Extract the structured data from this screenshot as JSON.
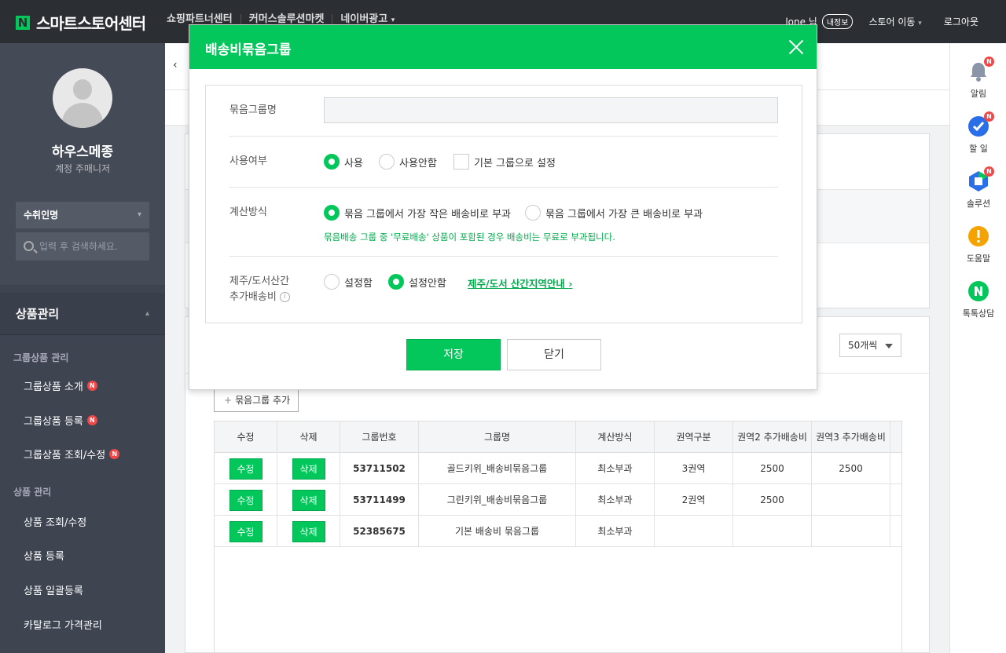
{
  "header": {
    "logo_letter": "N",
    "logo_text": "스마트스토어센터",
    "nav": [
      "쇼핑파트너센터",
      "커머스솔루션마켓",
      "네이버광고"
    ],
    "user": "lone 님",
    "info_badge": "내정보",
    "store_move": "스토어 이동",
    "logout": "로그아웃"
  },
  "sidebar": {
    "store_name": "하우스메종",
    "role": "계정 주매니저",
    "select_value": "수취인명",
    "search_placeholder": "입력 후 검색하세요.",
    "menu_head": "상품관리",
    "sections": [
      {
        "title": "그룹상품 관리",
        "items": [
          {
            "label": "그룹상품 소개",
            "badge": "N"
          },
          {
            "label": "그룹상품 등록",
            "badge": "N"
          },
          {
            "label": "그룹상품 조회/수정",
            "badge": "N"
          }
        ]
      },
      {
        "title": "상품 관리",
        "items": [
          {
            "label": "상품 조회/수정"
          },
          {
            "label": "상품 등록"
          },
          {
            "label": "상품 일괄등록"
          },
          {
            "label": "카탈로그 가격관리"
          }
        ]
      }
    ]
  },
  "main": {
    "per_page": "50개씩",
    "add_group": "묶음그룹 추가",
    "table": {
      "columns": [
        "수정",
        "삭제",
        "그룹번호",
        "그룹명",
        "계산방식",
        "권역구분",
        "권역2 추가배송비",
        "권역3 추가배송비"
      ],
      "edit_label": "수정",
      "delete_label": "삭제",
      "rows": [
        {
          "id": "53711502",
          "name": "골드키위_배송비묶음그룹",
          "method": "최소부과",
          "zone": "3권역",
          "zone2": "2500",
          "zone3": "2500"
        },
        {
          "id": "53711499",
          "name": "그린키위_배송비묶음그룹",
          "method": "최소부과",
          "zone": "2권역",
          "zone2": "2500",
          "zone3": ""
        },
        {
          "id": "52385675",
          "name": "기본 배송비 묶음그룹",
          "method": "최소부과",
          "zone": "",
          "zone2": "",
          "zone3": ""
        }
      ]
    }
  },
  "rail": [
    {
      "label": "알림",
      "icon": "bell-icon",
      "badge": "N"
    },
    {
      "label": "할 일",
      "icon": "check-icon",
      "badge": "N"
    },
    {
      "label": "솔루션",
      "icon": "solution-icon",
      "badge": "N"
    },
    {
      "label": "도움말",
      "icon": "help-icon"
    },
    {
      "label": "톡톡상담",
      "icon": "talk-icon"
    }
  ],
  "modal": {
    "title": "배송비묶음그룹",
    "group_name_label": "묶음그룹명",
    "group_name_value": "",
    "use_label": "사용여부",
    "use_on": "사용",
    "use_off": "사용안함",
    "default_group": "기본 그룹으로 설정",
    "calc_label": "계산방식",
    "calc_min": "묶음 그룹에서 가장 작은 배송비로 부과",
    "calc_max": "묶음 그룹에서 가장 큰 배송비로 부과",
    "calc_note": "묶음배송 그룹 중 '무료배송' 상품이 포함된 경우 배송비는 무료로 부과됩니다.",
    "island_label_1": "제주/도서산간",
    "island_label_2": "추가배송비",
    "island_set": "설정함",
    "island_unset": "설정안함",
    "island_link": "제주/도서 산간지역안내",
    "save": "저장",
    "close": "닫기"
  },
  "colors": {
    "accent": "#03c75a",
    "header_bg": "#2b2f33",
    "sidebar_bg": "#3e4450"
  }
}
